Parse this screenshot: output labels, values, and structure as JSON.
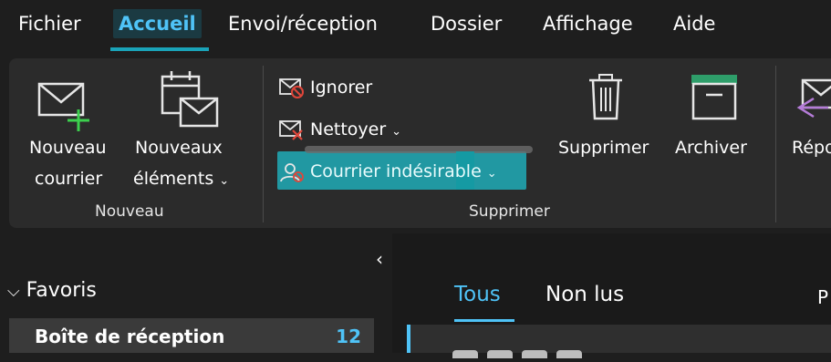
{
  "menu": {
    "items": [
      "Fichier",
      "Accueil",
      "Envoi/réception",
      "Dossier",
      "Affichage",
      "Aide"
    ],
    "active": "Accueil"
  },
  "ribbon": {
    "nouveau": {
      "new_mail_line1": "Nouveau",
      "new_mail_line2": "courrier",
      "new_items_line1": "Nouveaux",
      "new_items_line2": "éléments",
      "group_label": "Nouveau"
    },
    "supprimer": {
      "ignore": "Ignorer",
      "cleanup": "Nettoyer",
      "junk": "Courrier indésirable",
      "delete": "Supprimer",
      "archive": "Archiver",
      "group_label": "Supprimer"
    },
    "reply_partial": "Répo"
  },
  "folders": {
    "collapse_glyph": "‹",
    "favorites_label": "Favoris",
    "inbox_label": "Boîte de réception",
    "inbox_count": "12"
  },
  "message_list": {
    "tabs": [
      "Tous",
      "Non lus"
    ],
    "right_partial": "P"
  },
  "colors": {
    "accent": "#4fc3f7",
    "highlight": "#1fb7c4",
    "new_plus": "#3ccf4e",
    "archive_bar": "#2e9e6a",
    "reply_arrow": "#b57cd8",
    "junk_red": "#e0463a"
  }
}
